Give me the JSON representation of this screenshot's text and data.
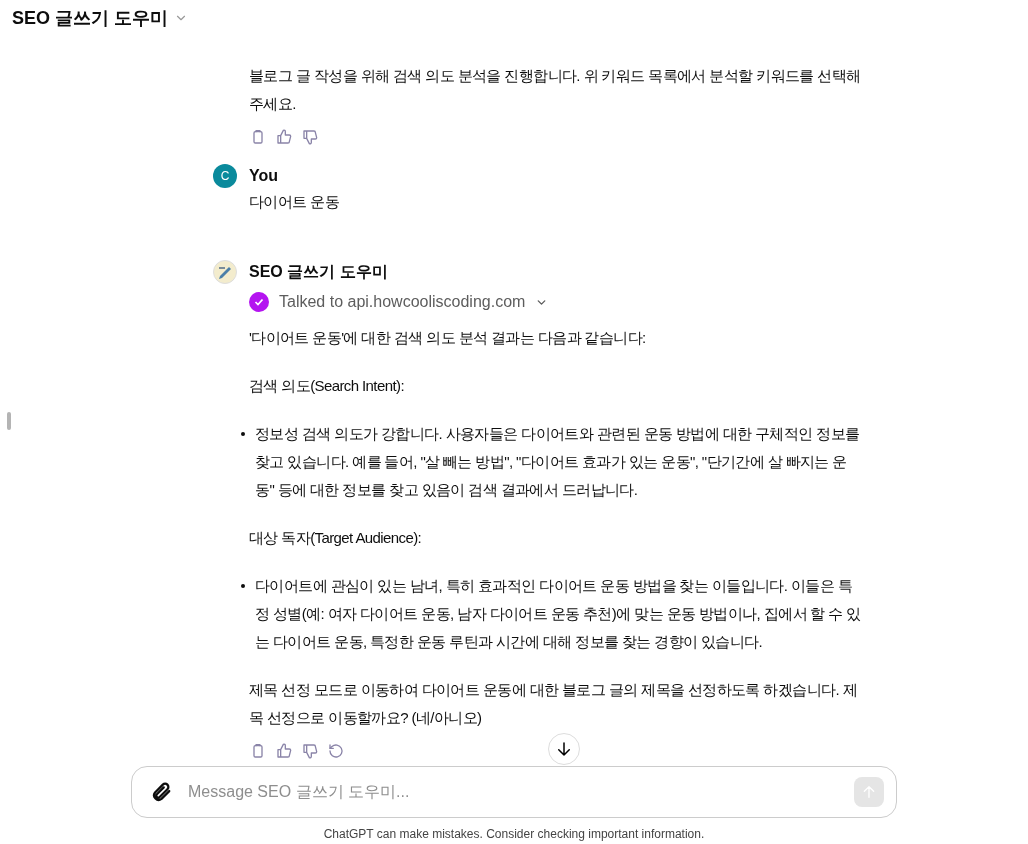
{
  "header": {
    "title": "SEO 글쓰기 도우미"
  },
  "messages": [
    {
      "kind": "assistant",
      "blocks": [
        {
          "kind": "paragraph",
          "text": "블로그 글 작성을 위해 검색 의도 분석을 진행합니다. 위 키워드 목록에서 분석할 키워드를 선택해 주세요."
        }
      ],
      "regenerate_button": false
    },
    {
      "kind": "user",
      "author": "You",
      "avatar": "C",
      "text": "다이어트 운동"
    },
    {
      "kind": "assistant",
      "author": "SEO 글쓰기 도우미",
      "tool": "Talked to api.howcooliscoding.com",
      "blocks": [
        {
          "kind": "paragraph",
          "text": "'다이어트 운동'에 대한 검색 의도 분석 결과는 다음과 같습니다:"
        },
        {
          "kind": "paragraph",
          "text": "검색 의도(Search Intent):"
        },
        {
          "kind": "bullet",
          "text": "정보성 검색 의도가 강합니다. 사용자들은 다이어트와 관련된 운동 방법에 대한 구체적인 정보를 찾고 있습니다. 예를 들어, \"살 빼는 방법\", \"다이어트 효과가 있는 운동\", \"단기간에 살 빠지는 운동\" 등에 대한 정보를 찾고 있음이 검색 결과에서 드러납니다."
        },
        {
          "kind": "paragraph",
          "text": "대상 독자(Target Audience):"
        },
        {
          "kind": "bullet",
          "text": "다이어트에 관심이 있는 남녀, 특히 효과적인 다이어트 운동 방법을 찾는 이들입니다. 이들은 특정 성별(예: 여자 다이어트 운동, 남자 다이어트 운동 추천)에 맞는 운동 방법이나, 집에서 할 수 있는 다이어트 운동, 특정한 운동 루틴과 시간에 대해 정보를 찾는 경향이 있습니다."
        },
        {
          "kind": "paragraph",
          "text": "제목 선정 모드로 이동하여 다이어트 운동에 대한 블로그 글의 제목을 선정하도록 하겠습니다. 제목 선정으로 이동할까요? (네/아니오)"
        }
      ],
      "regenerate_button": true
    }
  ],
  "composer": {
    "placeholder": "Message SEO 글쓰기 도우미..."
  },
  "footer": "ChatGPT can make mistakes. Consider checking important information."
}
